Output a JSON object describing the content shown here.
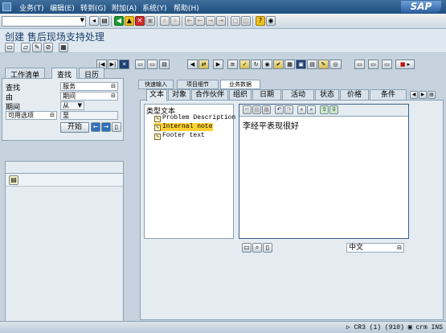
{
  "menubar": {
    "items": [
      "业务(T)",
      "编辑(E)",
      "转到(G)",
      "附加(A)",
      "系统(Y)",
      "帮助(H)"
    ],
    "logo": "SAP"
  },
  "stdbar": {
    "command_field_value": "",
    "icons": [
      "enter-icon",
      "save-icon",
      "back-icon",
      "exit-icon",
      "cancel-icon",
      "print-icon",
      "find-icon",
      "find-next-icon",
      "first-page-icon",
      "prev-page-icon",
      "next-page-icon",
      "last-page-icon",
      "new-session-icon",
      "shortcut-icon",
      "help-icon",
      "customize-layout-icon"
    ]
  },
  "title": "创建  售后现场支持处理",
  "left_pane": {
    "tabs": [
      "工作清单",
      "查找",
      "日历"
    ],
    "active_tab": "查找",
    "search": {
      "find_label": "查找",
      "find_value": "服务",
      "by_label": "由",
      "by_value": "期间",
      "period_label": "期间",
      "period_from_value": "从",
      "avail_label": "可用选项",
      "avail_value": "至",
      "start_button": "开始"
    }
  },
  "right_pane": {
    "quick_tabs": [
      "快速输入",
      "项目细节",
      "业务数据"
    ],
    "active_quick_tab": "业务数据",
    "main_tabs": [
      "文本",
      "对象",
      "合作伙伴",
      "组织",
      "日期",
      "活动",
      "状态",
      "价格",
      "条件"
    ],
    "active_main_tab": "文本",
    "text_types": {
      "header": "类型文本",
      "items": [
        "Problem Description",
        "Internal note",
        "Footer text"
      ],
      "selected": "Internal note"
    },
    "editor": {
      "content": "李经平表现很好"
    },
    "language": "中文"
  },
  "statusbar": {
    "info": "CR3 (1) (910)",
    "host": "crm",
    "mode": "INS"
  }
}
